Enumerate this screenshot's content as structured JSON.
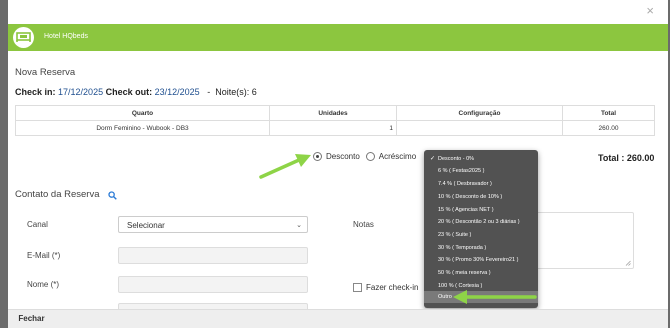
{
  "header": {
    "hotel_name": "Hotel HQbeds",
    "close_symbol": "×"
  },
  "title": "Nova Reserva",
  "stay": {
    "checkin_label": "Check in:",
    "checkin_date": "17/12/2025",
    "checkout_label": "Check out:",
    "checkout_date": "23/12/2025",
    "separator": "-",
    "nights": "Noite(s): 6"
  },
  "table": {
    "headers": [
      "Quarto",
      "Unidades",
      "Configuração",
      "Total"
    ],
    "rows": [
      [
        "Dorm Feminino - Wubook - DB3",
        "1",
        "",
        "260.00"
      ]
    ]
  },
  "pricing": {
    "desconto_label": "Desconto",
    "acrescimo_label": "Acréscimo",
    "total": "Total : 260.00"
  },
  "discount_options": [
    "Desconto - 0%",
    "6 % ( Festas2025 )",
    "7.4 % ( Desbravador )",
    "10 % ( Desconto de 10% )",
    "15 % ( Agencias NET )",
    "20 % ( Descontão 2 ou 3 diárias )",
    "23 % ( Suite )",
    "30 % ( Temporada )",
    "30 % ( Promo 30% Fevereiro21 )",
    "50 % ( meia reserva )",
    "100 % ( Cortesia )",
    "Outro"
  ],
  "contact": {
    "title": "Contato da Reserva",
    "canal_label": "Canal",
    "canal_value": "Selecionar",
    "email_label": "E-Mail (*)",
    "nome_label": "Nome (*)",
    "notas_label": "Notas",
    "checkin_checkbox_label": "Fazer check-in"
  },
  "footer": {
    "fechar_label": "Fechar"
  },
  "colors": {
    "header_green": "#8cc63f",
    "arrow_green": "#8ed447",
    "link_blue": "#1f4f8f"
  }
}
